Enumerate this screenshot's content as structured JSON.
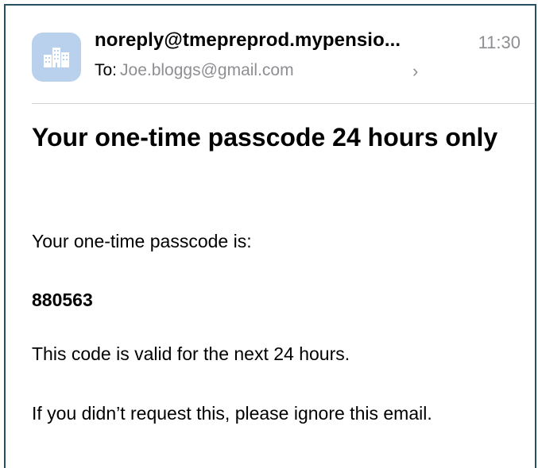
{
  "email": {
    "sender": "noreply@tmepreprod.mypensio...",
    "time": "11:30",
    "to_label": "To:",
    "to_address": "Joe.bloggs@gmail.com",
    "chevron": "›",
    "avatar_icon": "buildings-icon",
    "avatar_color": "#b9d1ec",
    "subject": "Your one-time passcode 24 hours only",
    "body": {
      "intro": "Your one-time passcode is:",
      "code": "880563",
      "validity": "This code is valid for the next 24 hours.",
      "ignore_note": "If you didn’t request this, please ignore this email."
    }
  }
}
